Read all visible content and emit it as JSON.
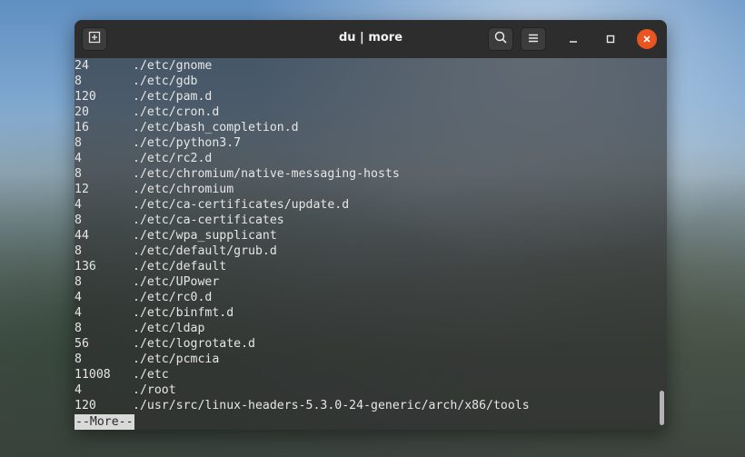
{
  "window": {
    "title": "du | more"
  },
  "terminal": {
    "lines": [
      {
        "size": "24",
        "path": "./etc/gnome"
      },
      {
        "size": "8",
        "path": "./etc/gdb"
      },
      {
        "size": "120",
        "path": "./etc/pam.d"
      },
      {
        "size": "20",
        "path": "./etc/cron.d"
      },
      {
        "size": "16",
        "path": "./etc/bash_completion.d"
      },
      {
        "size": "8",
        "path": "./etc/python3.7"
      },
      {
        "size": "4",
        "path": "./etc/rc2.d"
      },
      {
        "size": "8",
        "path": "./etc/chromium/native-messaging-hosts"
      },
      {
        "size": "12",
        "path": "./etc/chromium"
      },
      {
        "size": "4",
        "path": "./etc/ca-certificates/update.d"
      },
      {
        "size": "8",
        "path": "./etc/ca-certificates"
      },
      {
        "size": "44",
        "path": "./etc/wpa_supplicant"
      },
      {
        "size": "8",
        "path": "./etc/default/grub.d"
      },
      {
        "size": "136",
        "path": "./etc/default"
      },
      {
        "size": "8",
        "path": "./etc/UPower"
      },
      {
        "size": "4",
        "path": "./etc/rc0.d"
      },
      {
        "size": "4",
        "path": "./etc/binfmt.d"
      },
      {
        "size": "8",
        "path": "./etc/ldap"
      },
      {
        "size": "56",
        "path": "./etc/logrotate.d"
      },
      {
        "size": "8",
        "path": "./etc/pcmcia"
      },
      {
        "size": "11008",
        "path": "./etc"
      },
      {
        "size": "4",
        "path": "./root"
      },
      {
        "size": "120",
        "path": "./usr/src/linux-headers-5.3.0-24-generic/arch/x86/tools"
      }
    ],
    "pager_prompt": "--More--"
  },
  "icons": {
    "new_tab": "new-tab-icon",
    "search": "search-icon",
    "menu": "hamburger-menu-icon",
    "minimize": "minimize-icon",
    "maximize": "maximize-icon",
    "close": "close-icon"
  },
  "colors": {
    "close_button": "#e95420",
    "titlebar": "#2d2d2d",
    "terminal_text": "#e6e6e6"
  }
}
